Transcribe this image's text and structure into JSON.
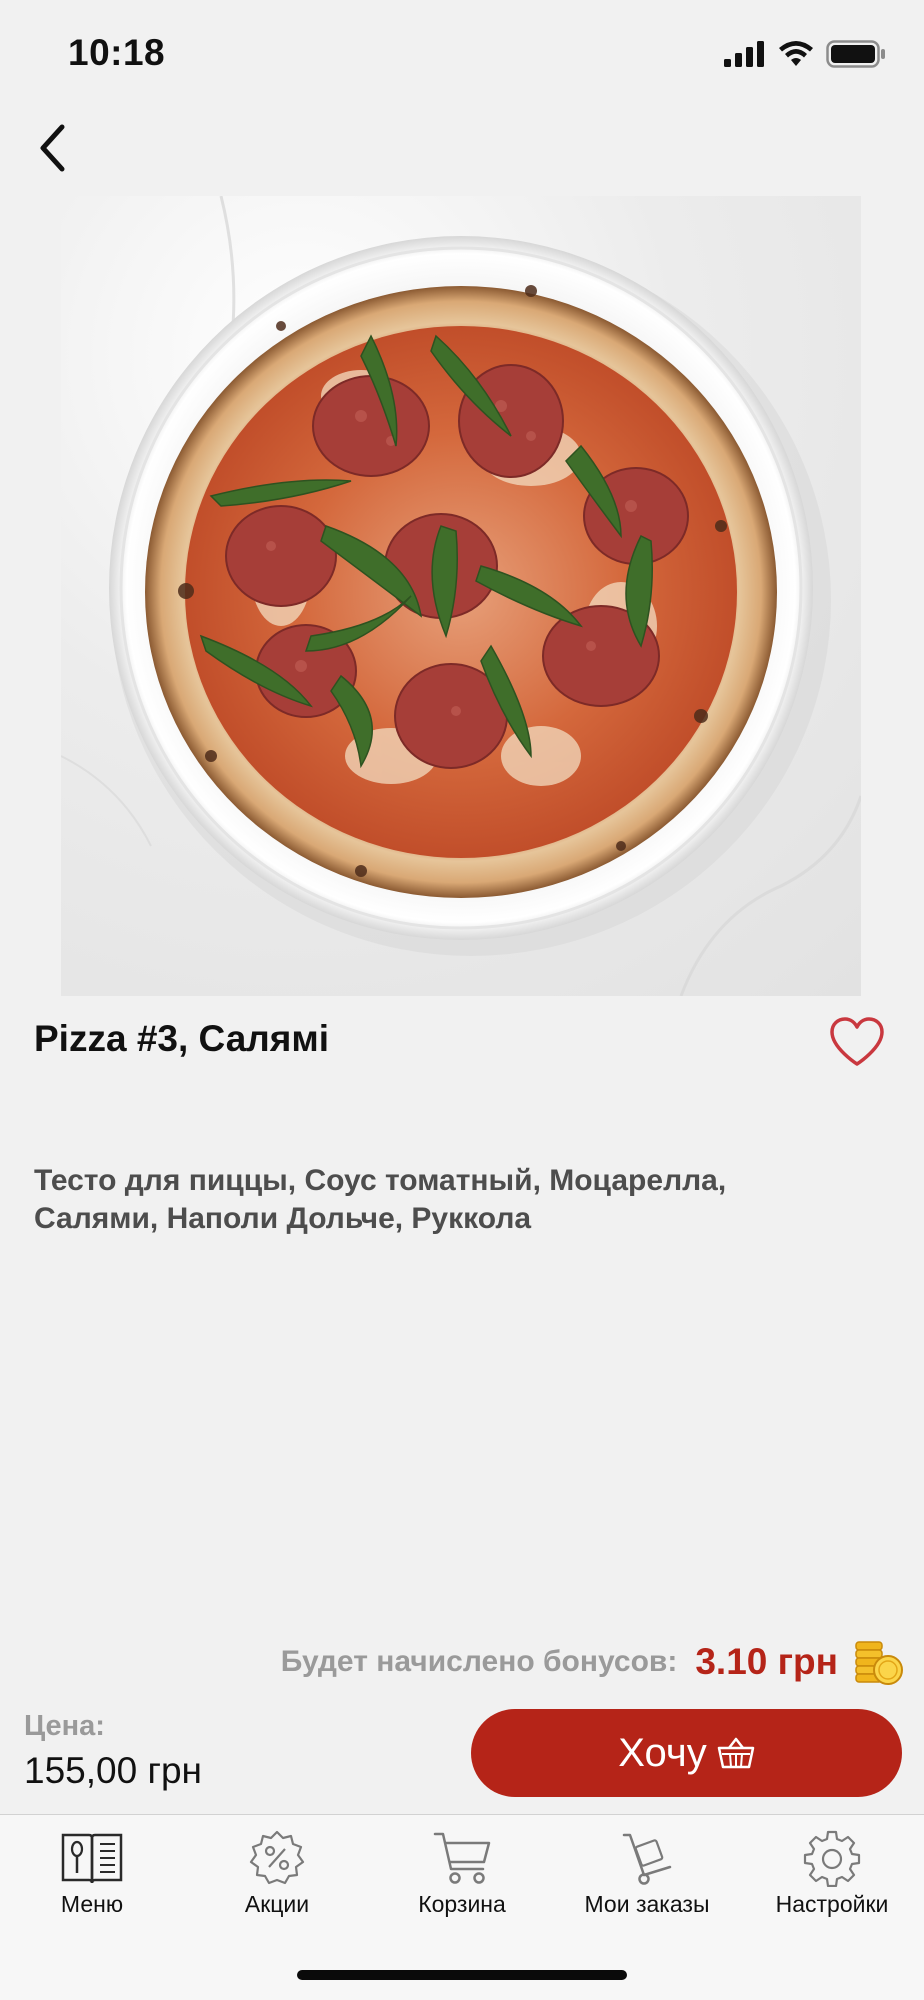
{
  "status_bar": {
    "time": "10:18"
  },
  "product": {
    "title": "Pizza #3, Салямі",
    "description": "Тесто для пиццы, Соус томатный, Моцарелла, Салями, Наполи Дольче, Руккола",
    "image_icon": "pizza-photo"
  },
  "bonus": {
    "label": "Будет начислено бонусов:",
    "amount": "3.10 грн"
  },
  "price": {
    "label": "Цена:",
    "value": "155,00 грн"
  },
  "actions": {
    "want_label": "Хочу"
  },
  "tabs": [
    {
      "label": "Меню",
      "icon": "menu-book-icon"
    },
    {
      "label": "Акции",
      "icon": "discount-badge-icon"
    },
    {
      "label": "Корзина",
      "icon": "cart-icon"
    },
    {
      "label": "Мои заказы",
      "icon": "delivery-cart-icon"
    },
    {
      "label": "Настройки",
      "icon": "gear-icon"
    }
  ],
  "colors": {
    "accent": "#b52418",
    "muted": "#9a9a9a",
    "background": "#f1f1f1",
    "favorite": "#c9383f"
  }
}
